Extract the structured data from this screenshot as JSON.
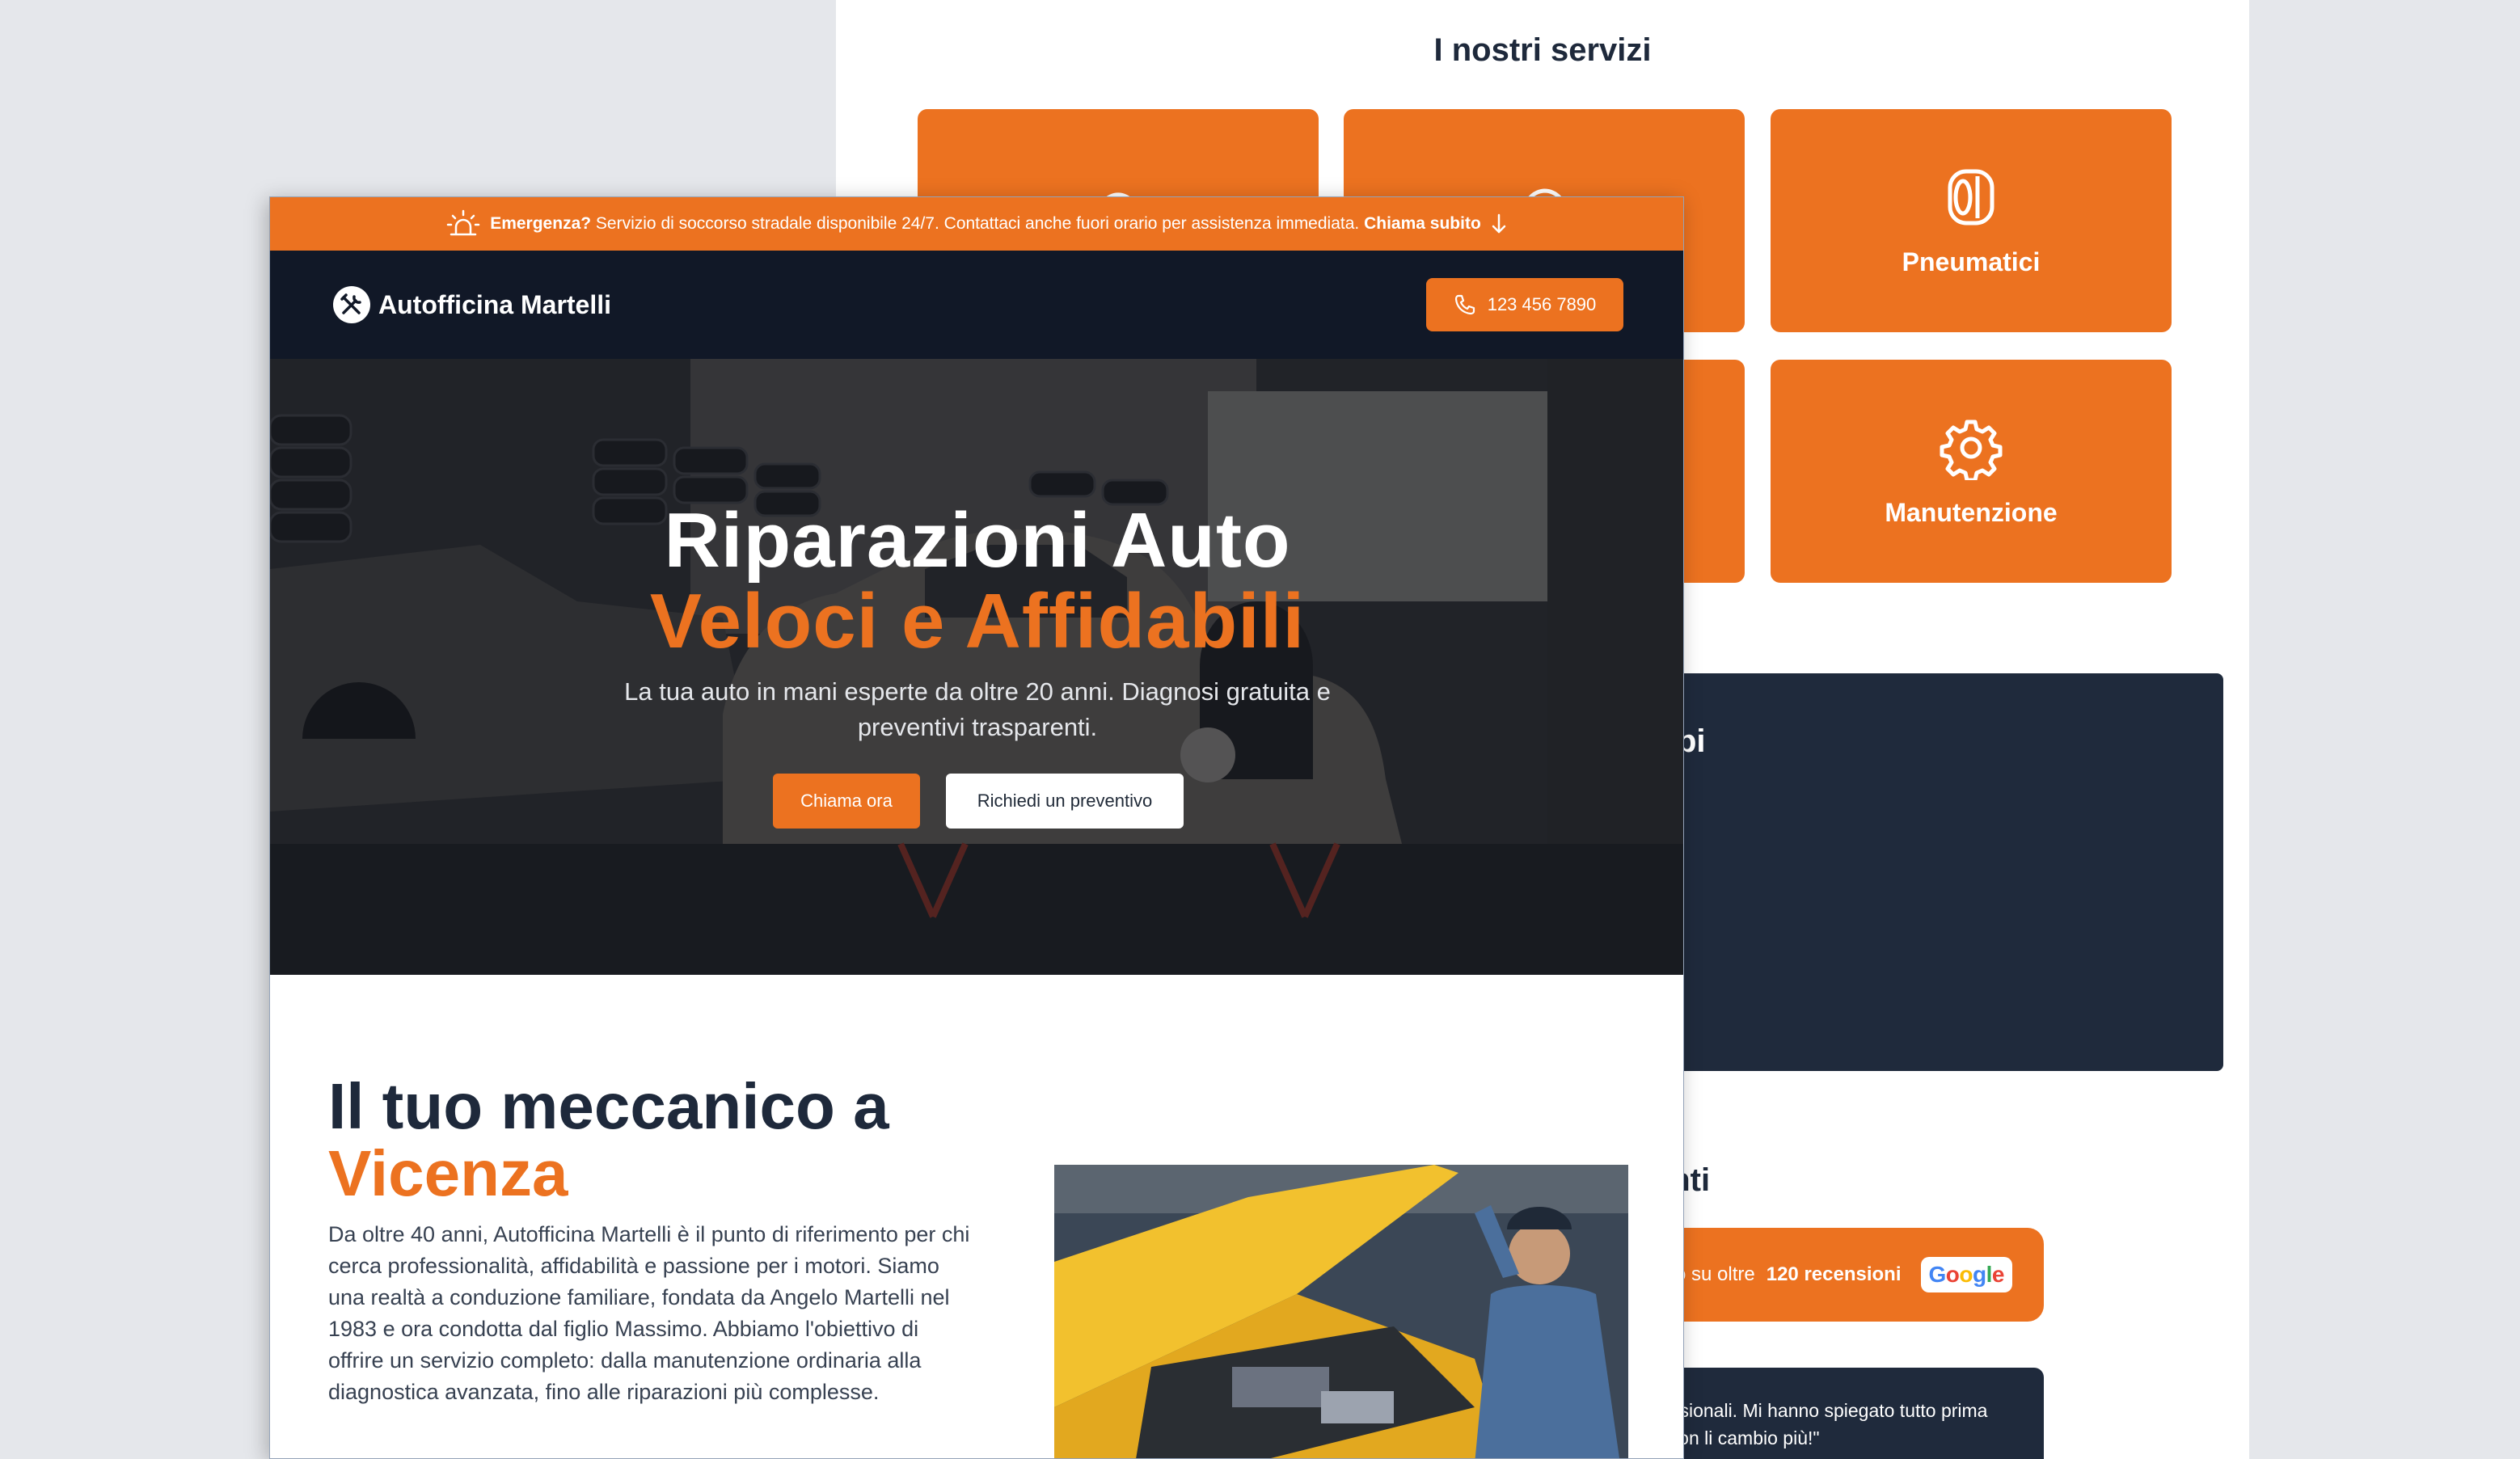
{
  "services": {
    "title": "I nostri servizi",
    "items": [
      {
        "label": "",
        "icon": "wrench-icon"
      },
      {
        "label": "",
        "icon": "brake-icon"
      },
      {
        "label": "Pneumatici",
        "icon": "tire-icon"
      },
      {
        "label": "",
        "icon": "service-icon"
      },
      {
        "label": "",
        "icon": "service-icon"
      },
      {
        "label": "Manutenzione",
        "icon": "gear-icon"
      }
    ]
  },
  "why": {
    "title_fragment": "pi"
  },
  "reviews": {
    "title_fragment": "enti",
    "rating_text": "ato su oltre",
    "rating_count": "120 recensioni",
    "google": "Google",
    "testimonial_line1": "ofessionali. Mi hanno spiegato tutto prima",
    "testimonial_line2": "e. Non li cambio più!\""
  },
  "emergency": {
    "label": "Emergenza?",
    "text": "Servizio di soccorso stradale disponibile 24/7. Contattaci anche fuori orario per assistenza immediata.",
    "cta": "Chiama subito"
  },
  "header": {
    "brand": "Autofficina Martelli",
    "phone": "123 456 7890"
  },
  "hero": {
    "title_line1": "Riparazioni Auto",
    "title_line2": "Veloci e Affidabili",
    "subtitle": "La tua auto in mani esperte da oltre 20 anni. Diagnosi gratuita e preventivi trasparenti.",
    "call_label": "Chiama ora",
    "quote_label": "Richiedi un preventivo"
  },
  "about": {
    "heading_line1": "Il tuo meccanico a",
    "heading_line2": "Vicenza",
    "text": "Da oltre 40 anni, Autofficina Martelli è il punto di riferimento per chi cerca professionalità, affidabilità e passione per i motori. Siamo una realtà a conduzione familiare, fondata da Angelo Martelli nel 1983 e ora condotta dal figlio Massimo. Abbiamo l'obiettivo di offrire un servizio completo: dalla manutenzione ordinaria alla diagnostica avanzata, fino alle riparazioni più complesse."
  },
  "colors": {
    "accent": "#ec7220",
    "dark": "#111827",
    "panel": "#1f2a3c",
    "background": "#e5e7eb"
  }
}
